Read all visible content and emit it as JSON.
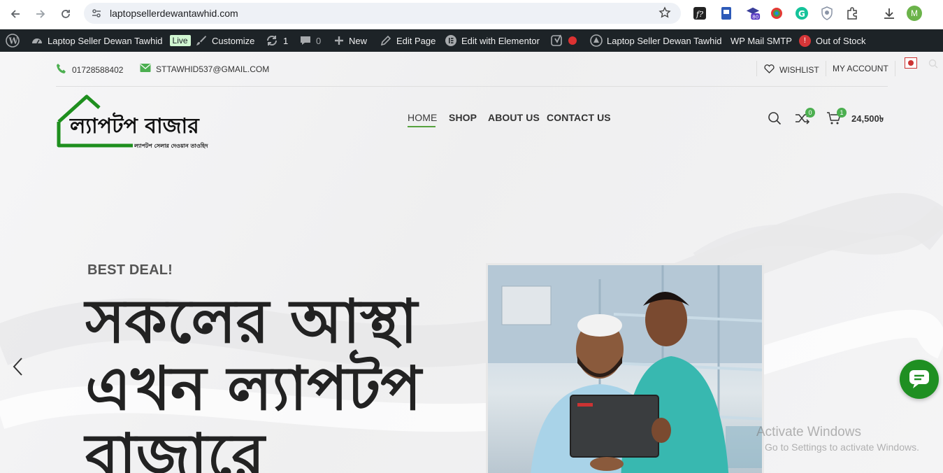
{
  "browser": {
    "url": "laptopsellerdewantawhid.com",
    "avatar_letter": "M",
    "ext_badge": "80"
  },
  "adminbar": {
    "site_name": "Laptop Seller Dewan Tawhid",
    "live": "Live",
    "customize": "Customize",
    "updates": "1",
    "comments": "0",
    "new": "New",
    "edit_page": "Edit Page",
    "edit_elementor": "Edit with Elementor",
    "site_name_2": "Laptop Seller Dewan Tawhid",
    "wp_mail_smtp": "WP Mail SMTP",
    "smtp_badge": "!",
    "out_of_stock": "Out of Stock"
  },
  "topbar": {
    "phone": "01728588402",
    "email": "STTAWHID537@GMAIL.COM",
    "wishlist": "WISHLIST",
    "my_account": "MY ACCOUNT"
  },
  "logo": {
    "main": "ল্যাপটপ বাজার",
    "tagline": "ল্যাপটপ সেলার দেওয়ান তাওহিদ"
  },
  "menu": {
    "items": [
      "HOME",
      "SHOP",
      "ABOUT US",
      "CONTACT US"
    ]
  },
  "header_icons": {
    "compare_count": "0",
    "cart_count": "1",
    "cart_total": "24,500৳"
  },
  "hero": {
    "eyebrow": "BEST DEAL!",
    "title_line1": "সকলের আস্থা",
    "title_line2": "এখন ল্যাপটপ",
    "title_line3": "বাজারে"
  },
  "watermark": {
    "line1": "Activate Windows",
    "line2": "Go to Settings to activate Windows."
  },
  "colors": {
    "accent_green": "#57a33f",
    "adminbar_bg": "#1d2327",
    "chat_green": "#1f8f22"
  }
}
